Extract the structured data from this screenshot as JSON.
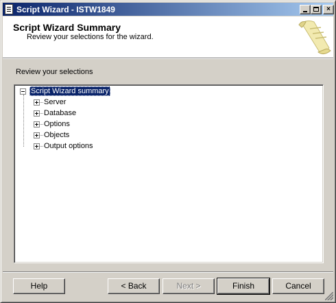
{
  "window": {
    "title": "Script Wizard - ISTW1849",
    "minimize_label": "_",
    "close_label": "×"
  },
  "header": {
    "title": "Script Wizard Summary",
    "subtitle": "Review your selections for the wizard."
  },
  "content": {
    "section_label": "Review your selections",
    "tree": {
      "root": {
        "label": "Script Wizard summary",
        "expanded": true,
        "selected": true
      },
      "children": [
        {
          "label": "Server",
          "expanded": false
        },
        {
          "label": "Database",
          "expanded": false
        },
        {
          "label": "Options",
          "expanded": false
        },
        {
          "label": "Objects",
          "expanded": false
        },
        {
          "label": "Output options",
          "expanded": false
        }
      ]
    }
  },
  "buttons": {
    "help": "Help",
    "back": "< Back",
    "next": "Next >",
    "finish": "Finish",
    "cancel": "Cancel"
  },
  "colors": {
    "titlebar_start": "#0a246a",
    "titlebar_end": "#a6caf0",
    "face": "#d4d0c8",
    "selection": "#0a246a"
  },
  "icons": {
    "title": "script-wizard-icon",
    "header_art": "scroll-parchment-icon"
  }
}
